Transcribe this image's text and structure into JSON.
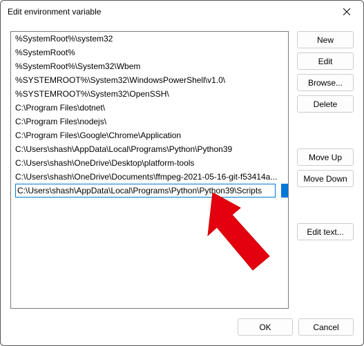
{
  "dialog": {
    "title": "Edit environment variable"
  },
  "list": {
    "items": [
      "%SystemRoot%\\system32",
      "%SystemRoot%",
      "%SystemRoot%\\System32\\Wbem",
      "%SYSTEMROOT%\\System32\\WindowsPowerShell\\v1.0\\",
      "%SYSTEMROOT%\\System32\\OpenSSH\\",
      "C:\\Program Files\\dotnet\\",
      "C:\\Program Files\\nodejs\\",
      "C:\\Program Files\\Google\\Chrome\\Application",
      "C:\\Users\\shash\\AppData\\Local\\Programs\\Python\\Python39",
      "C:\\Users\\shash\\OneDrive\\Desktop\\platform-tools",
      "C:\\Users\\shash\\OneDrive\\Documents\\ffmpeg-2021-05-16-git-f53414a..."
    ],
    "editing_value": "C:\\Users\\shash\\AppData\\Local\\Programs\\Python\\Python39\\Scripts"
  },
  "buttons": {
    "new": "New",
    "edit": "Edit",
    "browse": "Browse...",
    "delete": "Delete",
    "move_up": "Move Up",
    "move_down": "Move Down",
    "edit_text": "Edit text...",
    "ok": "OK",
    "cancel": "Cancel"
  }
}
